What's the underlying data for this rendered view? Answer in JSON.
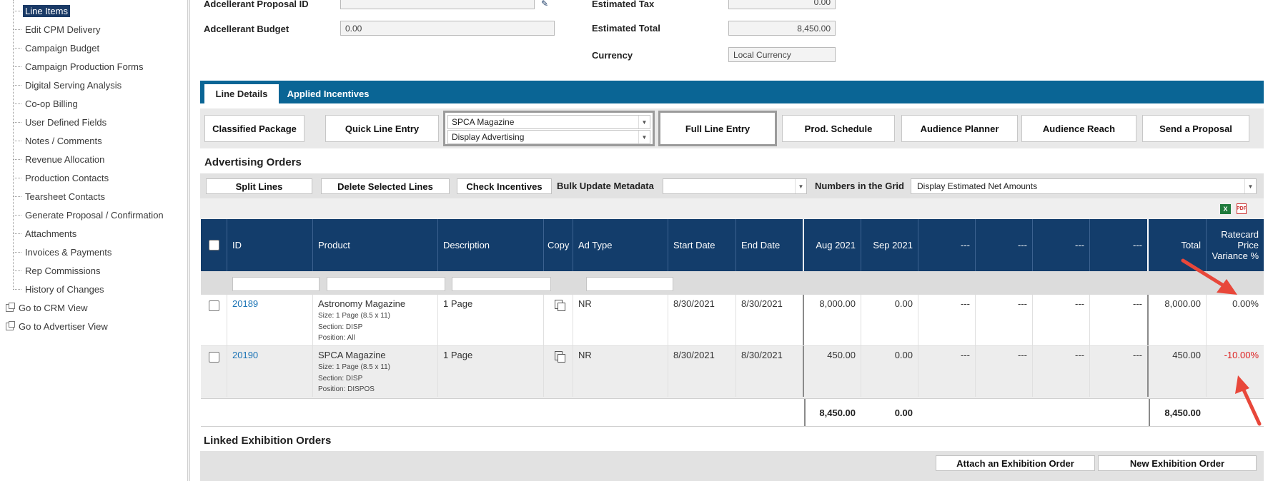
{
  "sidebar": {
    "items": [
      {
        "label": "Line Items",
        "active": true
      },
      {
        "label": "Edit CPM Delivery"
      },
      {
        "label": "Campaign Budget"
      },
      {
        "label": "Campaign Production Forms"
      },
      {
        "label": "Digital Serving Analysis"
      },
      {
        "label": "Co-op Billing"
      },
      {
        "label": "User Defined Fields"
      },
      {
        "label": "Notes / Comments"
      },
      {
        "label": "Revenue Allocation"
      },
      {
        "label": "Production Contacts"
      },
      {
        "label": "Tearsheet Contacts"
      },
      {
        "label": "Generate Proposal / Confirmation"
      },
      {
        "label": "Attachments"
      },
      {
        "label": "Invoices & Payments"
      },
      {
        "label": "Rep Commissions"
      },
      {
        "label": "History of Changes"
      }
    ],
    "roots": [
      {
        "label": "Go to CRM View"
      },
      {
        "label": "Go to Advertiser View"
      }
    ]
  },
  "form": {
    "adcellerant_proposal_id_label": "Adcellerant Proposal ID",
    "adcellerant_proposal_id_value": "",
    "adcellerant_budget_label": "Adcellerant Budget",
    "adcellerant_budget_value": "0.00",
    "estimated_tax_label": "Estimated Tax",
    "estimated_tax_value": "0.00",
    "estimated_total_label": "Estimated Total",
    "estimated_total_value": "8,450.00",
    "currency_label": "Currency",
    "currency_value": "Local Currency"
  },
  "tabs": [
    {
      "label": "Line Details",
      "active": true
    },
    {
      "label": "Applied Incentives",
      "active": false
    }
  ],
  "toolbar": {
    "classified_package": "Classified Package",
    "quick_line_entry": "Quick Line Entry",
    "publication_select": "SPCA Magazine",
    "section_select": "Display Advertising",
    "full_line_entry": "Full Line Entry",
    "prod_schedule": "Prod. Schedule",
    "audience_planner": "Audience Planner",
    "audience_reach": "Audience Reach",
    "send_proposal": "Send a Proposal"
  },
  "advertising_orders": {
    "title": "Advertising Orders",
    "split_lines": "Split Lines",
    "delete_selected": "Delete Selected Lines",
    "check_incentives": "Check Incentives",
    "bulk_update_label": "Bulk Update Metadata",
    "bulk_update_value": "",
    "numbers_label": "Numbers in the Grid",
    "numbers_value": "Display Estimated Net Amounts",
    "export_excel": "X",
    "export_pdf": "PDF"
  },
  "grid": {
    "headers": {
      "id": "ID",
      "product": "Product",
      "description": "Description",
      "copy": "Copy",
      "ad_type": "Ad Type",
      "start_date": "Start Date",
      "end_date": "End Date",
      "aug": "Aug 2021",
      "sep": "Sep 2021",
      "blank": "---",
      "total": "Total",
      "variance": "Ratecard Price Variance %"
    },
    "rows": [
      {
        "id": "20189",
        "product": "Astronomy Magazine",
        "size": "Size: 1 Page (8.5 x 11)",
        "section": "Section: DISP",
        "position": "Position: All",
        "description": "1 Page",
        "ad_type": "NR",
        "start": "8/30/2021",
        "end": "8/30/2021",
        "aug": "8,000.00",
        "sep": "0.00",
        "blank": "---",
        "total": "8,000.00",
        "variance": "0.00%"
      },
      {
        "id": "20190",
        "product": "SPCA Magazine",
        "size": "Size: 1 Page (8.5 x 11)",
        "section": "Section: DISP",
        "position": "Position: DISPOS",
        "description": "1 Page",
        "ad_type": "NR",
        "start": "8/30/2021",
        "end": "8/30/2021",
        "aug": "450.00",
        "sep": "0.00",
        "blank": "---",
        "total": "450.00",
        "variance": "-10.00%"
      }
    ],
    "totals": {
      "aug": "8,450.00",
      "sep": "0.00",
      "total": "8,450.00"
    }
  },
  "linked_exhibition": {
    "title": "Linked Exhibition Orders",
    "attach": "Attach an Exhibition Order",
    "new": "New Exhibition Order"
  },
  "colors": {
    "header_navy": "#133d6b",
    "tab_blue": "#0a6595",
    "link": "#1a73b5",
    "negative": "#d22222",
    "annotation_arrow": "#e8473a"
  }
}
